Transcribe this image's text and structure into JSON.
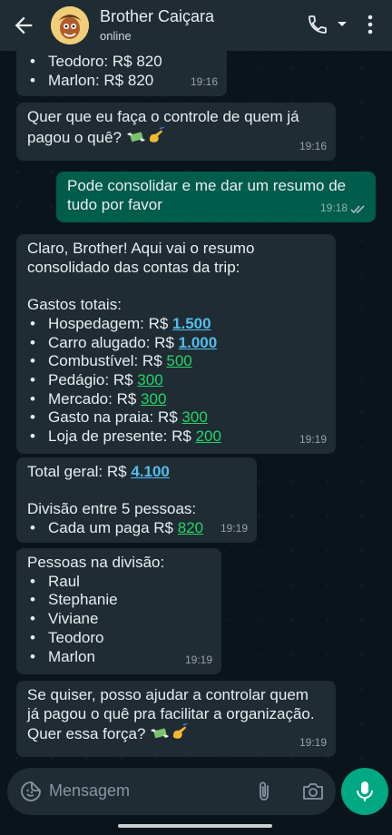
{
  "header": {
    "contact_name": "Brother Caiçara",
    "status": "online"
  },
  "messages": [
    {
      "direction": "in",
      "lines": [
        "Teodoro: R$ 820",
        "Marlon: R$ 820"
      ],
      "time": "19:16"
    },
    {
      "direction": "in",
      "lines": [
        "Quer que eu faça o controle de quem já",
        "pagou o quê?"
      ],
      "time": "19:16"
    },
    {
      "direction": "out",
      "lines": [
        "Pode consolidar e me dar um resumo de",
        "tudo por favor"
      ],
      "time": "19:18",
      "read": true
    },
    {
      "direction": "in",
      "intro": [
        "Claro, Brother! Aqui vai o resumo",
        "consolidado das contas da trip:"
      ],
      "section_title": "Gastos totais:",
      "items": [
        {
          "label": "Hospedagem: R$ ",
          "value": "1.500"
        },
        {
          "label": "Carro alugado: R$ ",
          "value": "1.000"
        },
        {
          "label": "Combustível: R$ ",
          "value": "500"
        },
        {
          "label": "Pedágio: R$ ",
          "value": "300"
        },
        {
          "label": "Mercado: R$ ",
          "value": "300"
        },
        {
          "label": "Gasto na praia: R$ ",
          "value": "300"
        },
        {
          "label": "Loja de presente: R$ ",
          "value": "200"
        }
      ],
      "time": "19:19"
    },
    {
      "direction": "in",
      "total_label": "Total geral: R$ ",
      "total_value": "4.100",
      "division_title": "Divisão entre 5 pessoas:",
      "each_label": "Cada um paga R$ ",
      "each_value": "820",
      "time": "19:19"
    },
    {
      "direction": "in",
      "title": "Pessoas na divisão:",
      "people": [
        "Raul",
        "Stephanie",
        "Viviane",
        "Teodoro",
        "Marlon"
      ],
      "time": "19:19"
    },
    {
      "direction": "in",
      "lines": [
        "Se quiser, posso ajudar a controlar quem",
        "já pagou o quê pra facilitar a organização.",
        "Quer essa força?"
      ],
      "time": "19:19"
    }
  ],
  "input": {
    "placeholder": "Mensagem"
  },
  "colors": {
    "header_bg": "#1f2c34",
    "chat_bg": "#0b141a",
    "incoming_bubble": "#1f2c34",
    "outgoing_bubble": "#005c4b",
    "link_blue": "#53bdeb",
    "link_green": "#25d366",
    "mic_button": "#00a884"
  },
  "icons": [
    "back-arrow-icon",
    "avatar",
    "phone-icon",
    "dropdown-icon",
    "more-vert-icon",
    "money-wings-emoji",
    "writing-hand-emoji",
    "sticker-icon",
    "attach-icon",
    "camera-icon",
    "mic-icon",
    "double-check-icon"
  ]
}
